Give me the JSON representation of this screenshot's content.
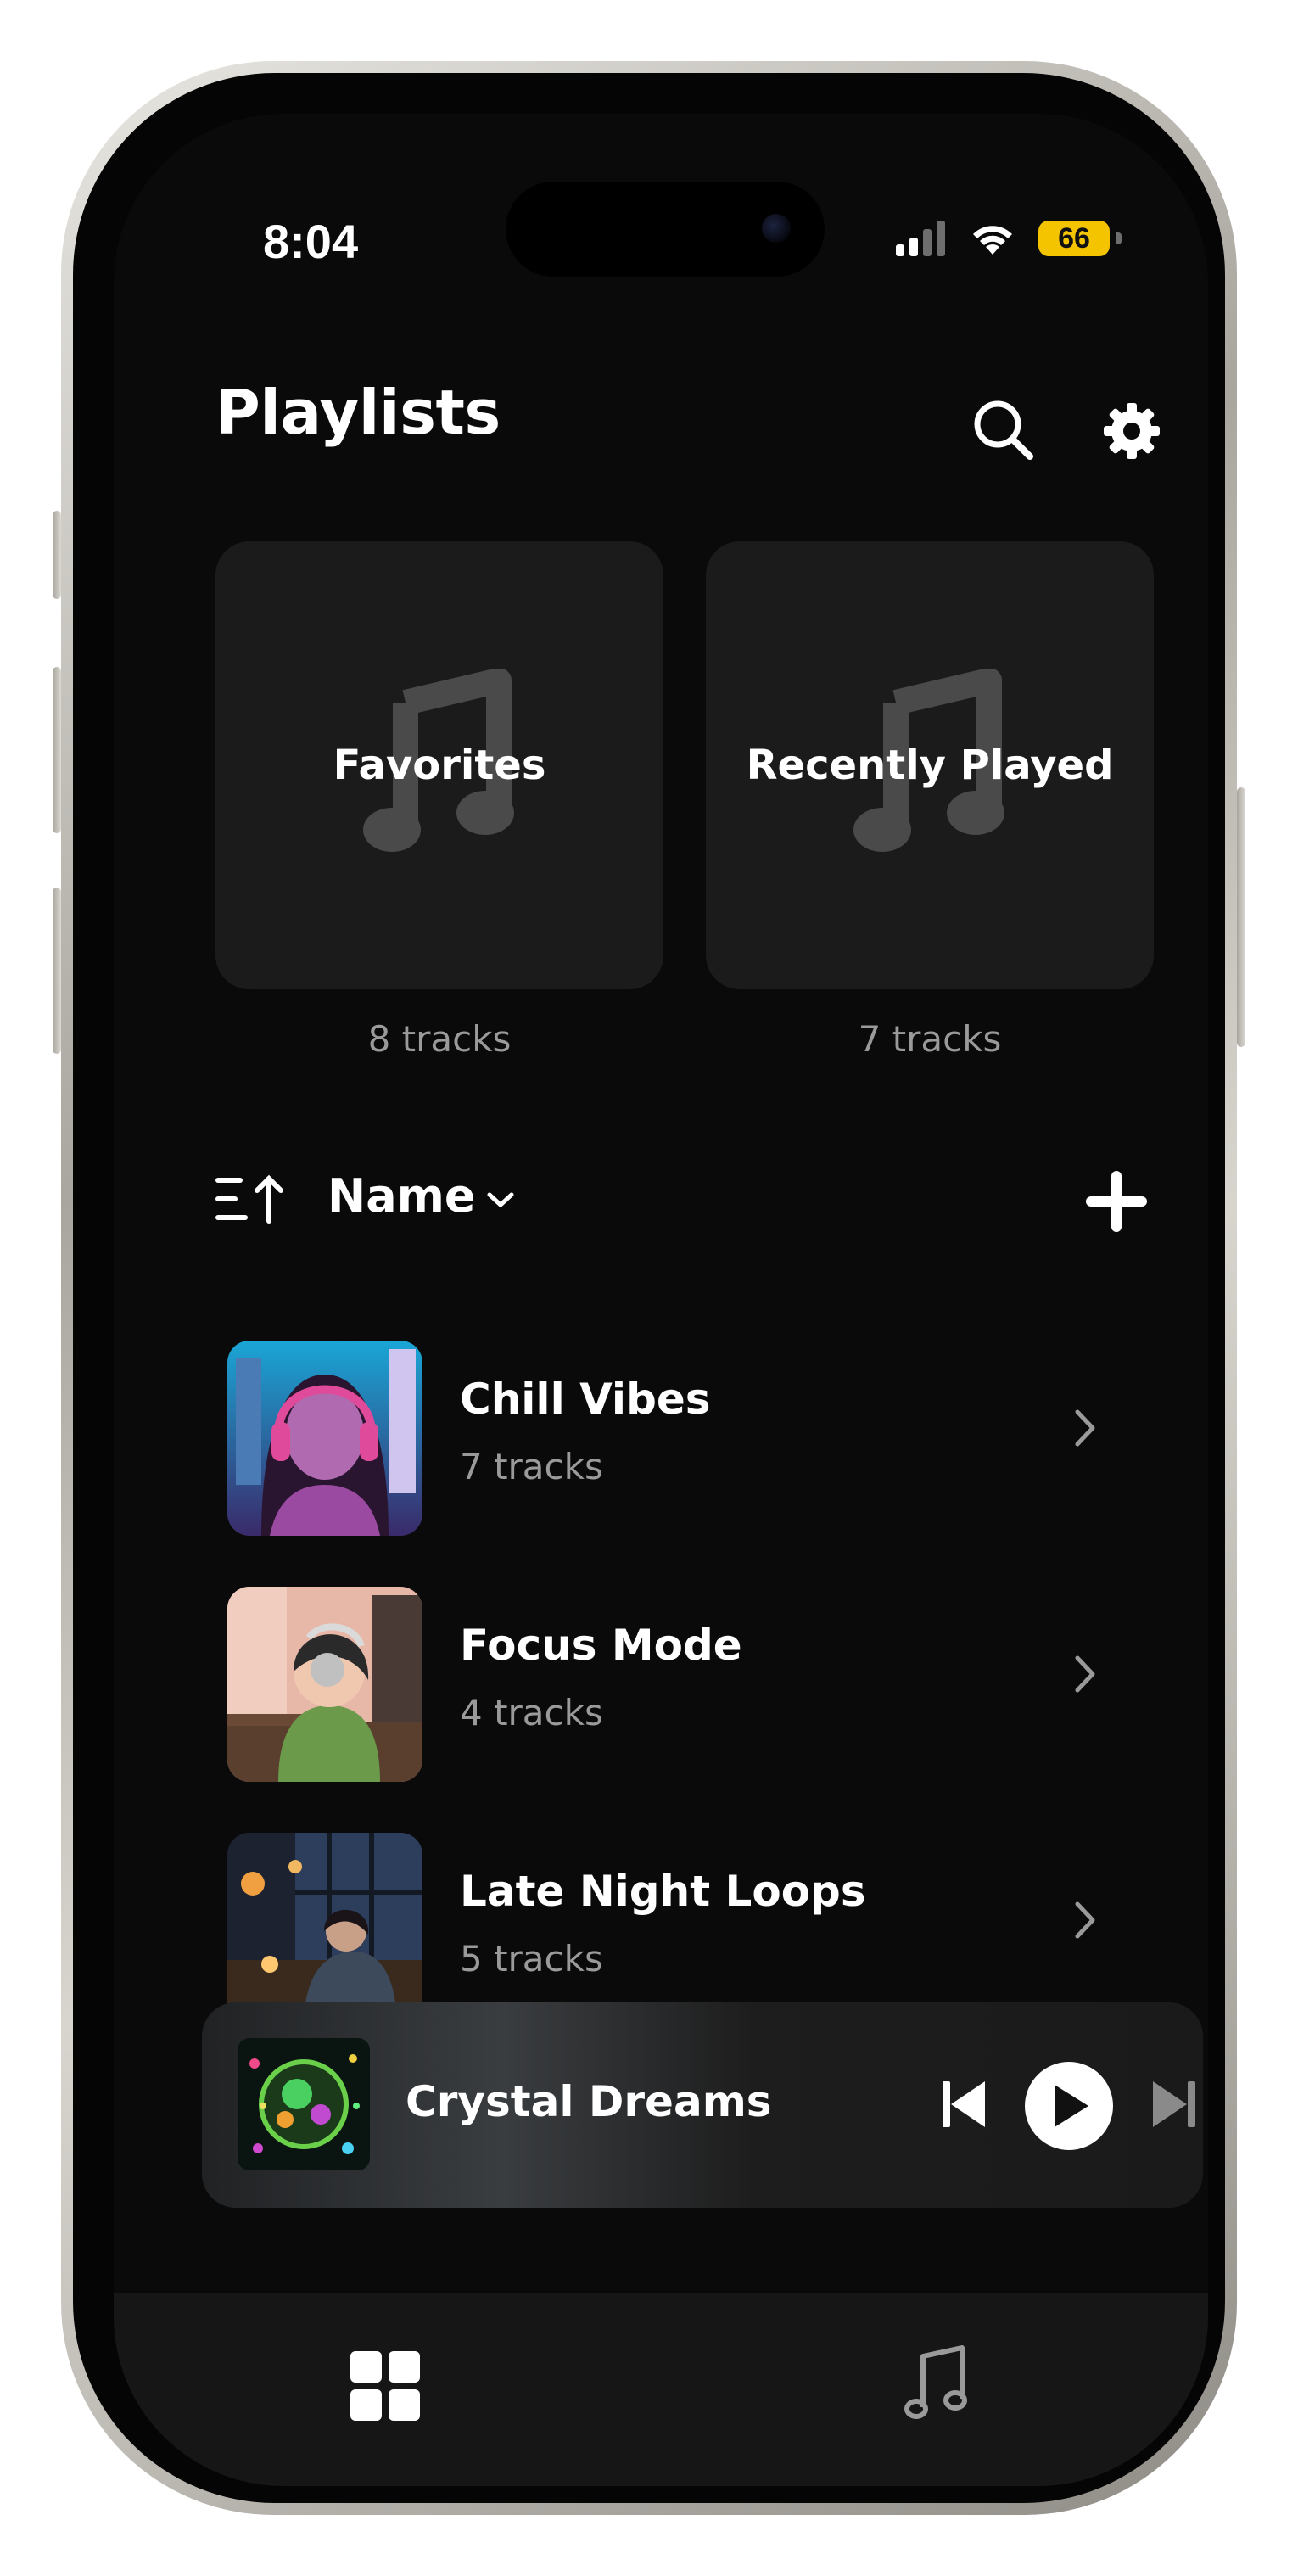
{
  "status_bar": {
    "time": "8:04",
    "battery": "66",
    "icons": [
      "signal-icon",
      "wifi-icon",
      "battery-icon"
    ]
  },
  "header": {
    "title": "Playlists",
    "icons": [
      "search-icon",
      "gear-icon"
    ]
  },
  "featured": [
    {
      "title": "Favorites",
      "count": "8 tracks"
    },
    {
      "title": "Recently Played",
      "count": "7 tracks"
    }
  ],
  "sort": {
    "label": "Name",
    "icons": [
      "sort-ascending-icon",
      "chevron-down-icon",
      "plus-icon"
    ]
  },
  "playlists": [
    {
      "title": "Chill Vibes",
      "count": "7 tracks"
    },
    {
      "title": "Focus Mode",
      "count": "4 tracks"
    },
    {
      "title": "Late Night Loops",
      "count": "5 tracks"
    }
  ],
  "now_playing": {
    "title": "Crystal Dreams",
    "icons": [
      "skip-back-icon",
      "play-icon",
      "skip-forward-icon"
    ]
  },
  "tab_bar": {
    "tabs": [
      "grid-icon",
      "music-note-icon"
    ],
    "active": "grid-icon"
  },
  "colors": {
    "background": "#0a0a0a",
    "card": "#1b1b1b",
    "secondary_text": "#9a9a9a",
    "battery": "#f5c400"
  }
}
